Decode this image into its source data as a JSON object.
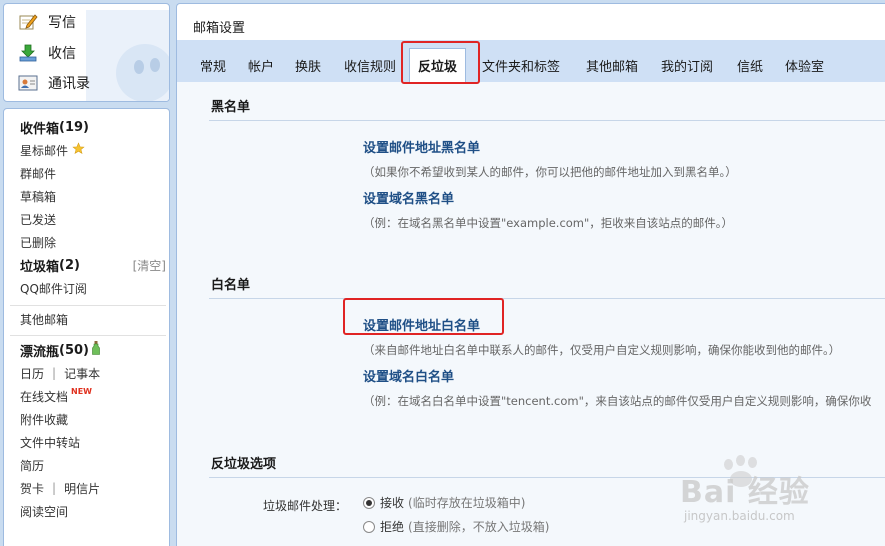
{
  "quick_actions": {
    "compose": "写信",
    "receive": "收信",
    "contacts": "通讯录"
  },
  "sidebar": {
    "inbox_label": "收件箱",
    "inbox_count": "(19)",
    "starred": "星标邮件",
    "group_mail": "群邮件",
    "drafts": "草稿箱",
    "sent": "已发送",
    "deleted": "已删除",
    "spam_label": "垃圾箱",
    "spam_count": "(2)",
    "spam_clear": "[清空]",
    "qq_subscription": "QQ邮件订阅",
    "other_mailbox": "其他邮箱",
    "drift_bottle_label": "漂流瓶",
    "drift_bottle_count": "(50)",
    "calendar": "日历",
    "notepad": "记事本",
    "online_docs": "在线文档",
    "new_badge": "NEW",
    "attachments": "附件收藏",
    "file_transfer": "文件中转站",
    "resume": "简历",
    "greeting_card": "贺卡",
    "postcard": "明信片",
    "reading_space": "阅读空间"
  },
  "main": {
    "title": "邮箱设置",
    "tabs": [
      "常规",
      "帐户",
      "换肤",
      "收信规则",
      "反垃圾",
      "文件夹和标签",
      "其他邮箱",
      "我的订阅",
      "信纸",
      "体验室"
    ],
    "active_tab": "反垃圾"
  },
  "blacklist": {
    "title": "黑名单",
    "address_link": "设置邮件地址黑名单",
    "address_hint": "（如果你不希望收到某人的邮件，你可以把他的邮件地址加入到黑名单。）",
    "domain_link": "设置域名黑名单",
    "domain_hint": "（例：在域名黑名单中设置\"example.com\"，拒收来自该站点的邮件。）"
  },
  "whitelist": {
    "title": "白名单",
    "address_link": "设置邮件地址白名单",
    "address_hint": "（来自邮件地址白名单中联系人的邮件，仅受用户自定义规则影响，确保你能收到他的邮件。）",
    "domain_link": "设置域名白名单",
    "domain_hint": "（例：在域名白名单中设置\"tencent.com\"，来自该站点的邮件仅受用户自定义规则影响，确保你收"
  },
  "spam_options": {
    "title": "反垃圾选项",
    "handling_label": "垃圾邮件处理：",
    "accept": "接收",
    "accept_hint": "(临时存放在垃圾箱中)",
    "reject": "拒绝",
    "reject_hint": "(直接删除，不放入垃圾箱)",
    "selected": "accept"
  },
  "watermark": {
    "brand": "Bai 经验",
    "url": "jingyan.baidu.com"
  },
  "colors": {
    "link": "#1f4f86",
    "highlight": "#e02424",
    "tabbar": "#cfe0f5",
    "content_bg": "#f4f8fc"
  }
}
